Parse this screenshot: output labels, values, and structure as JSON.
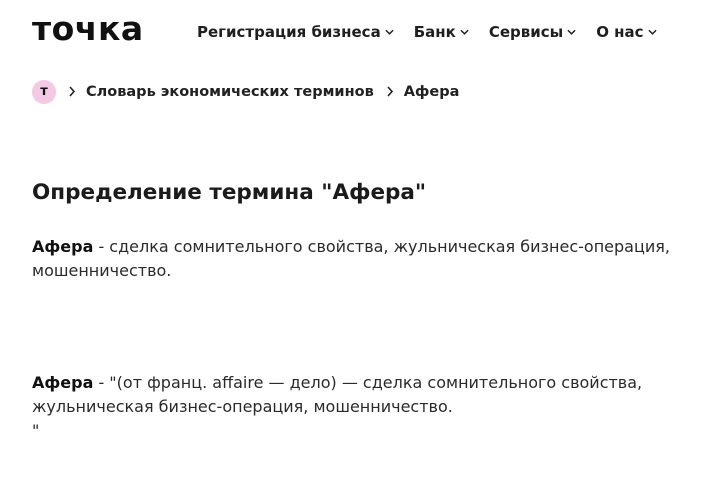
{
  "header": {
    "logo": "точка",
    "nav": [
      {
        "label": "Регистрация бизнеса"
      },
      {
        "label": "Банк"
      },
      {
        "label": "Сервисы"
      },
      {
        "label": "О нас"
      }
    ]
  },
  "breadcrumb": {
    "home_badge": "т",
    "items": [
      {
        "label": "Словарь экономических терминов"
      },
      {
        "label": "Афера"
      }
    ]
  },
  "main": {
    "title": "Определение термина \"Афера\"",
    "definition1": {
      "term": "Афера",
      "text": " - сделка сомнительного свойства, жульническая бизнес-операция, мошенничество."
    },
    "definition2": {
      "term": "Афера",
      "text": " - \"(от франц. affaire — дело) — сделка сомнительного свойства, жульническая бизнес-операция, мошенничество.",
      "trailing": "\""
    }
  }
}
